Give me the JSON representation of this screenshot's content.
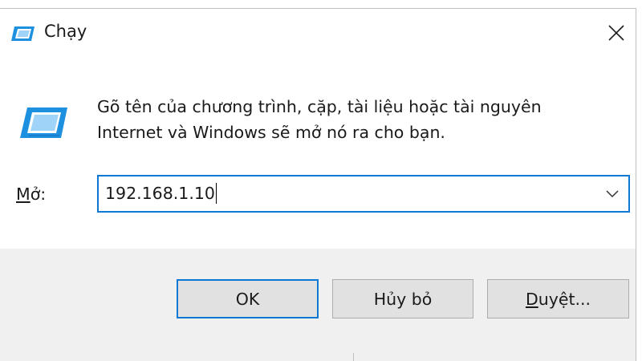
{
  "window": {
    "title": "Chạy"
  },
  "content": {
    "description_line1": "Gõ tên của chương trình, cặp, tài liệu hoặc tài nguyên",
    "description_line2": "Internet và Windows sẽ mở nó ra cho bạn.",
    "open_label_mnemonic": "M",
    "open_label_rest": "ở:",
    "open_value": "192.168.1.10"
  },
  "buttons": {
    "ok_label": "OK",
    "cancel_label": "Hủy bỏ",
    "browse_mnemonic": "D",
    "browse_rest": "uyệt..."
  },
  "colors": {
    "accent": "#0a78d4",
    "footer_bg": "#f0f0f0",
    "button_bg": "#e1e1e1",
    "icon_blue": "#1e90e0"
  },
  "icons": {
    "title_icon": "run-app-icon",
    "content_icon": "run-app-icon",
    "close": "close-icon",
    "dropdown": "chevron-down-icon"
  }
}
